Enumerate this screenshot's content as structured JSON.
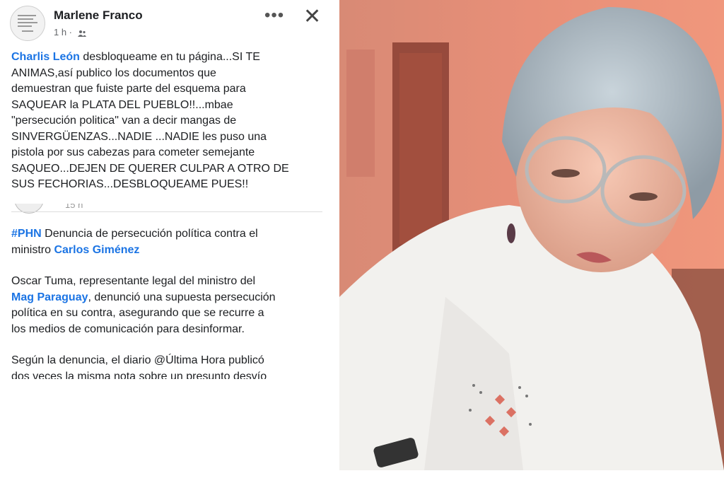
{
  "post": {
    "author": "Marlene Franco",
    "time": "1 h ·",
    "privacy_icon": "friends-icon",
    "more_icon": "more-icon",
    "close_icon": "close-icon",
    "mention": "Charlis León",
    "lines": [
      " desbloqueame en tu página...SI TE",
      "ANIMAS,así publico los documentos que",
      "demuestran que fuiste parte del esquema para",
      "SAQUEAR la PLATA DEL PUEBLO!!...mbae",
      "\"persecución politica\" van a decir mangas de",
      "SINVERGÜENZAS...NADIE ...NADIE les puso una",
      "pistola por sus cabezas para cometer semejante",
      "SAQUEO...DEJEN DE QUERER CULPAR A OTRO DE",
      "SUS FECHORIAS...DESBLOQUEAME PUES!!"
    ]
  },
  "shared": {
    "time_partial": "15 h",
    "hashtag": "#PHN",
    "line1_rest": " Denuncia de persecución política contra el",
    "line2_pre": "ministro ",
    "minister": "Carlos Giménez",
    "p2_line1": "Oscar Tuma, representante legal del ministro del",
    "p2_link": "Mag Paraguay",
    "p2_line2_rest": ", denunció una supuesta persecución",
    "p2_line3": "política en su contra, asegurando que se recurre a",
    "p2_line4": "los medios de comunicación para desinformar.",
    "p3_line1": "Según la denuncia, el diario @Última Hora publicó",
    "p3_line2": "dos veces la misma nota sobre un presunto desvío"
  },
  "colors": {
    "link": "#1b74e4",
    "text": "#1c1e21",
    "muted": "#65676b"
  }
}
